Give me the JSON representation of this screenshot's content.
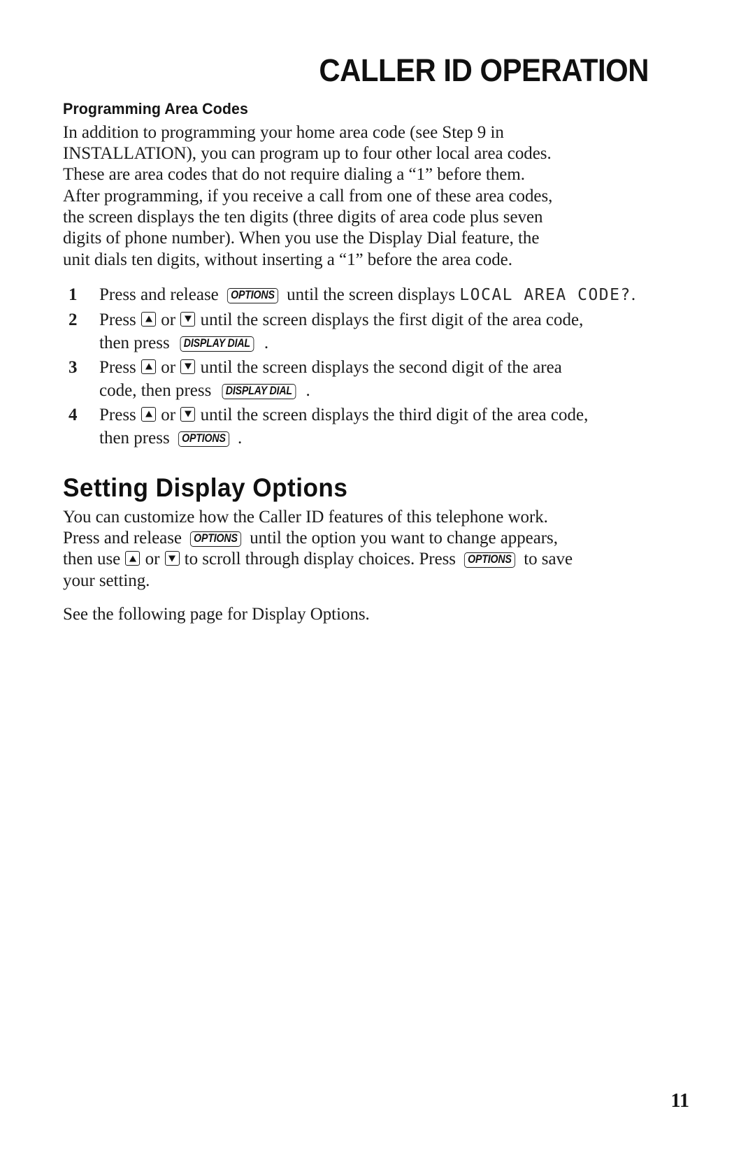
{
  "document": {
    "chapter_title": "CALLER ID OPERATION",
    "page_number": "11"
  },
  "section_area_codes": {
    "subheading": "Programming Area Codes",
    "intro_lines": [
      "In addition to programming your home area code (see Step 9 in",
      "INSTALLATION), you can program up to four other local area codes.",
      "These are area codes that do not require dialing a “1” before them.",
      "After programming, if you receive a call from one of these area codes,",
      "the screen displays the ten digits (three digits of area code plus seven",
      "digits of phone number). When you use the Display Dial feature, the",
      "unit dials ten digits, without inserting a “1” before the area code."
    ],
    "steps": [
      {
        "number": "1",
        "line1_a": "Press and release",
        "key1": "OPTIONS",
        "line1_b": "until the screen displays",
        "lcd": "LOCAL AREA CODE?",
        "line1_c": "."
      },
      {
        "number": "2",
        "line1_a": "Press",
        "arrow_up": "up-arrow-key",
        "line1_or": "or",
        "arrow_down": "down-arrow-key",
        "line1_b": "until the screen displays the first digit of the area code,",
        "line2_a": "then press",
        "key1": "DISPLAY DIAL",
        "line2_b": "."
      },
      {
        "number": "3",
        "line1_a": "Press",
        "arrow_up": "up-arrow-key",
        "line1_or": "or",
        "arrow_down": "down-arrow-key",
        "line1_b": "until the screen displays the second digit of the area",
        "line2_a": "code, then press",
        "key1": "DISPLAY DIAL",
        "line2_b": "."
      },
      {
        "number": "4",
        "line1_a": "Press",
        "arrow_up": "up-arrow-key",
        "line1_or": "or",
        "arrow_down": "down-arrow-key",
        "line1_b": "until the screen displays the third digit of the area code,",
        "line2_a": "then press",
        "key1": "OPTIONS",
        "line2_b": "."
      }
    ]
  },
  "section_display_options": {
    "heading": "Setting Display Options",
    "line1": "You can customize how the Caller ID features of this telephone work.",
    "line2_a": "Press and release",
    "line2_key": "OPTIONS",
    "line2_b": "until the option you want to change appears,",
    "line3_a": "then use",
    "line3_or": "or",
    "line3_b": "to scroll through display choices.  Press",
    "line3_key": "OPTIONS",
    "line3_c": "to save",
    "line4": "your setting.",
    "closing": "See the following page for Display Options."
  }
}
